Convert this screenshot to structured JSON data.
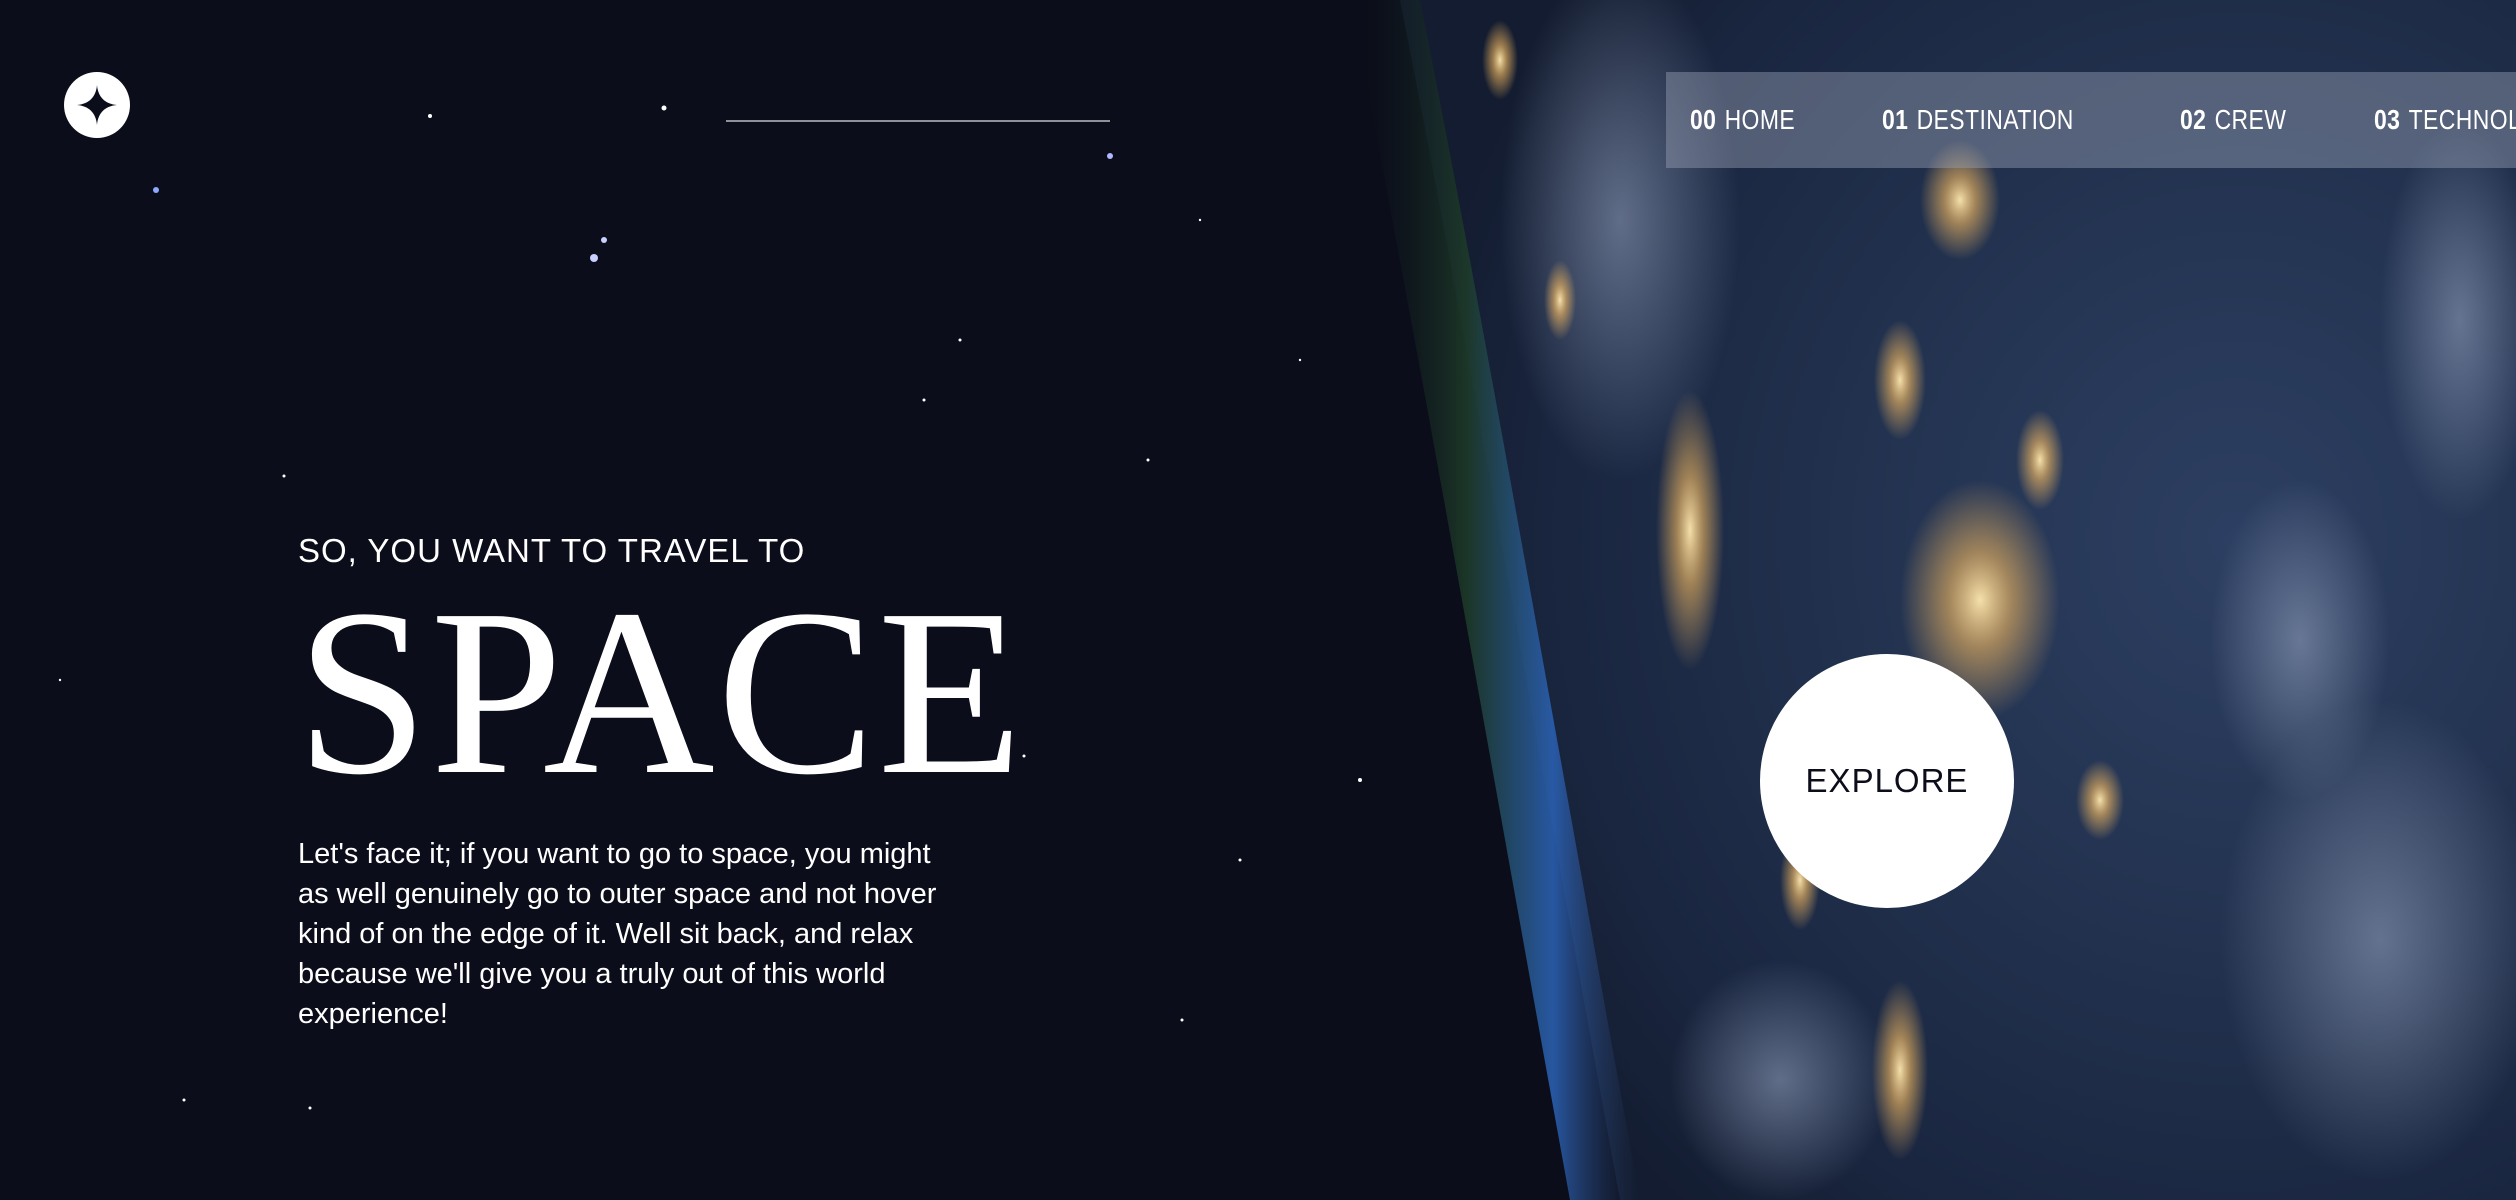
{
  "header": {
    "logo_icon": "star-icon"
  },
  "nav": {
    "items": [
      {
        "number": "00",
        "label": "HOME"
      },
      {
        "number": "01",
        "label": "DESTINATION"
      },
      {
        "number": "02",
        "label": "CREW"
      },
      {
        "number": "03",
        "label": "TECHNOLOGY"
      }
    ]
  },
  "hero": {
    "kicker": "SO, YOU WANT TO TRAVEL TO",
    "title": "SPACE",
    "description": "Let's face it; if you want to go to space, you might as well genuinely go to outer space and not hover kind of on the edge of it. Well sit back, and relax because we'll give you a truly out of this world experience!",
    "explore_label": "EXPLORE"
  },
  "colors": {
    "background": "#0b0d1a",
    "text": "#ffffff",
    "nav_background": "rgba(150,160,180,0.45)"
  }
}
